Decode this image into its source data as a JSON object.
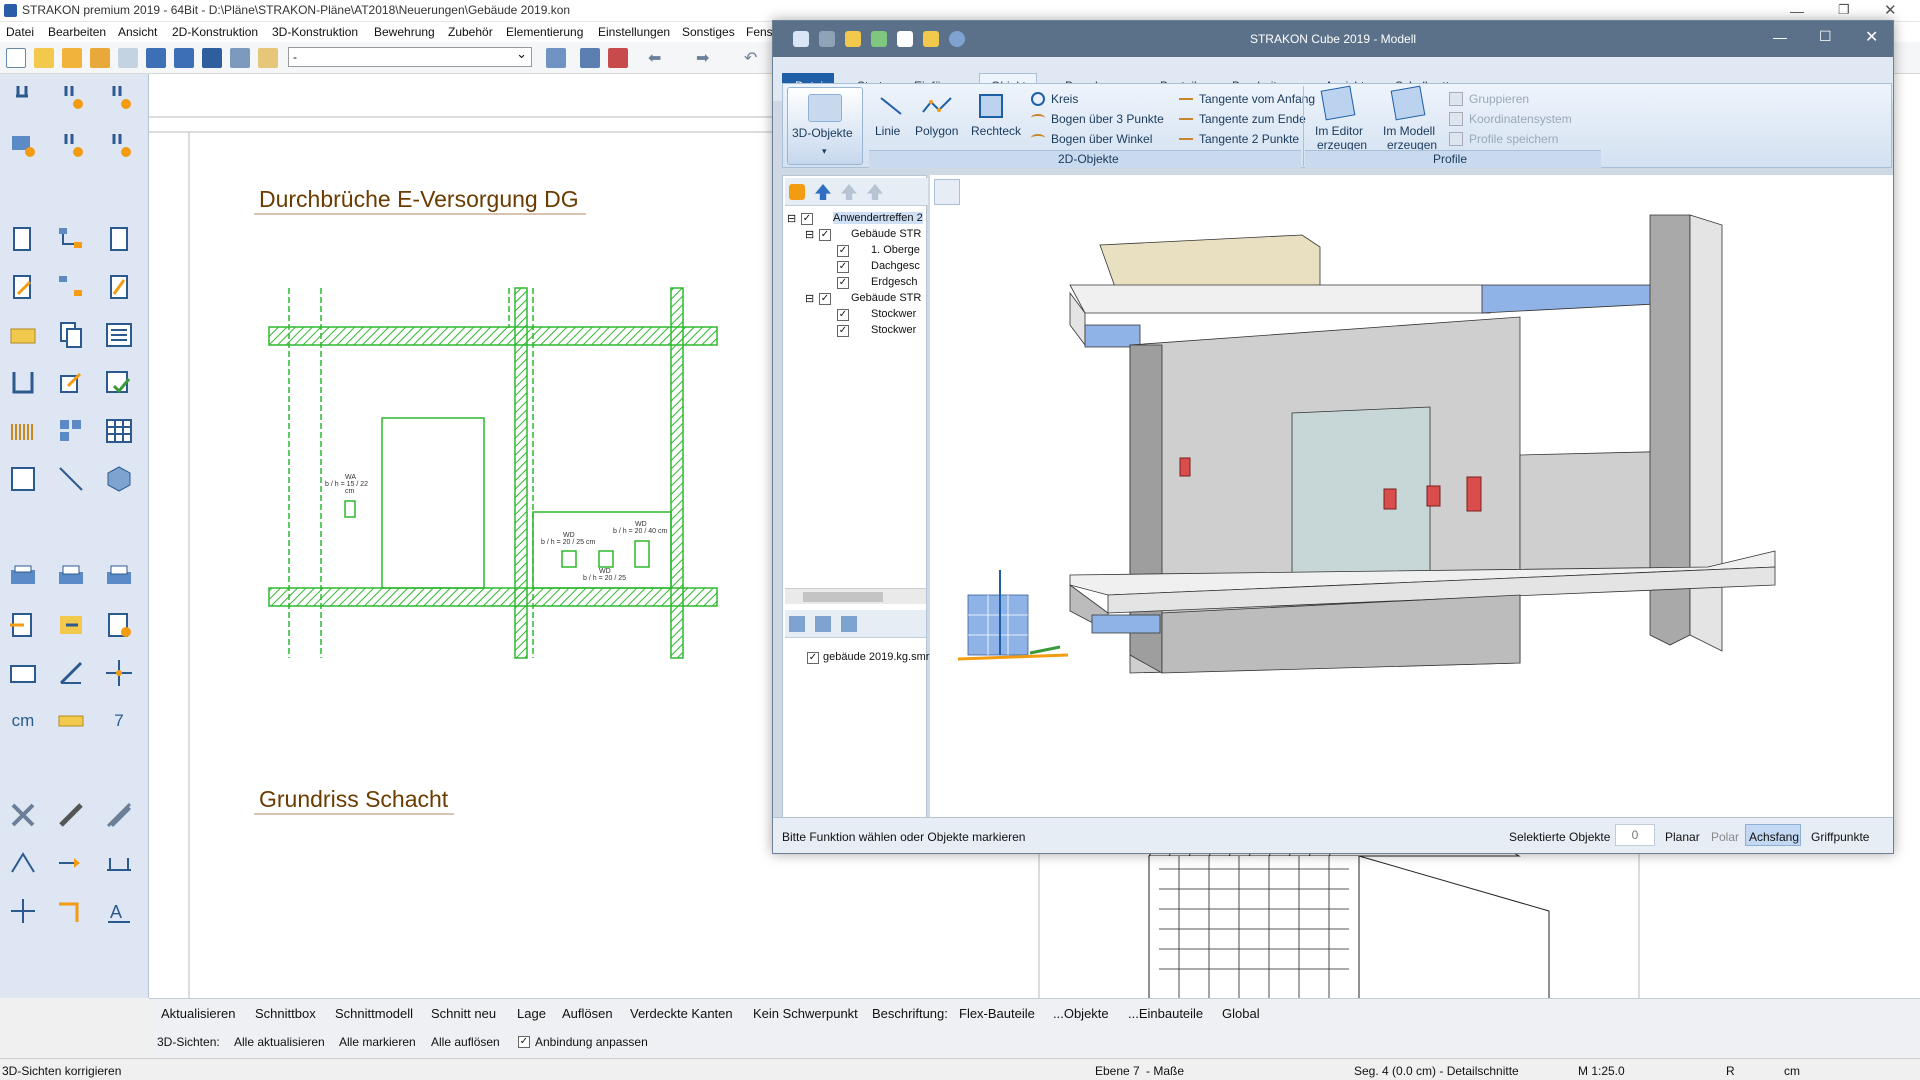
{
  "main_title": "STRAKON premium 2019 - 64Bit  -  D:\\Pläne\\STRAKON-Pläne\\AT2018\\Neuerungen\\Gebäude 2019.kon",
  "menu": [
    "Datei",
    "Bearbeiten",
    "Ansicht",
    "2D-Konstruktion",
    "3D-Konstruktion",
    "Bewehrung",
    "Zubehör",
    "Elementierung",
    "Einstellungen",
    "Sonstiges",
    "Fens"
  ],
  "layer_select": "-",
  "left_tools": {
    "cm": "cm",
    "seven": "7"
  },
  "drawing": {
    "title1": "Durchbrüche E-Versorgung DG",
    "title2": "Grundriss Schacht",
    "label_wa": "WA",
    "label_wa_dim": "b / h = 15 / 22",
    "label_wa_unit": "cm",
    "label_wd1": "WD",
    "label_wd1_dim": "b / h = 20 / 25 cm",
    "label_wd2": "WD",
    "label_wd2_dim": "b / h = 20 / 40 cm",
    "label_wd3": "WD",
    "label_wd3_dim": "b / h = 20 / 25"
  },
  "command_bar": [
    "Aktualisieren",
    "Schnittbox",
    "Schnittmodell",
    "Schnitt neu",
    "Lage",
    "Auflösen",
    "Verdeckte Kanten",
    "Kein Schwerpunkt",
    "Beschriftung:",
    "Flex-Bauteile",
    "...Objekte",
    "...Einbauteile",
    "Global"
  ],
  "view_bar": {
    "label": "3D-Sichten:",
    "items": [
      "Alle aktualisieren",
      "Alle markieren",
      "Alle auflösen"
    ],
    "checkbox": "Anbindung anpassen"
  },
  "statusbar": {
    "left": "3D-Sichten korrigieren",
    "ebene": "Ebene 7",
    "masse": "- Maße",
    "seg": "Seg. 4 (0.0 cm) - Detailschnitte",
    "scale": "M 1:25.0",
    "r": "R",
    "unit": "cm"
  },
  "cube": {
    "title": "STRAKON Cube 2019 - Modell",
    "tabs": [
      "Datei",
      "Start",
      "Einfügen",
      "Objekte",
      "Bewehrung",
      "Bauteile",
      "Bearbeiten",
      "Ansicht",
      "Schalbretter"
    ],
    "active_tab": "Objekte",
    "ribbon": {
      "objects3d": "3D-Objekte",
      "linie": "Linie",
      "polygon": "Polygon",
      "rechteck": "Rechteck",
      "kreis": "Kreis",
      "bogen3": "Bogen über 3 Punkte",
      "bogenw": "Bogen über Winkel",
      "tan_anfang": "Tangente vom Anfang",
      "tan_ende": "Tangente zum Ende",
      "tan_2": "Tangente 2 Punkte",
      "group_2d": "2D-Objekte",
      "im_editor1": "Im Editor",
      "im_editor2": "erzeugen",
      "im_modell1": "Im Modell",
      "im_modell2": "erzeugen",
      "gruppieren": "Gruppieren",
      "koord": "Koordinatensystem",
      "profile_speichern": "Profile speichern",
      "group_profile": "Profile"
    },
    "tree": [
      "Anwendertreffen 2",
      "Gebäude STR",
      "1. Oberge",
      "Dachgesc",
      "Erdgesch",
      "Gebäude STR",
      "Stockwer",
      "Stockwer"
    ],
    "file_item": "gebäude 2019.kg.smr",
    "status_left": "Bitte Funktion wählen oder Objekte markieren",
    "sel_label": "Selektierte Objekte",
    "sel_count": "0",
    "modes": [
      "Planar",
      "Polar",
      "Achsfang",
      "Griffpunkte"
    ],
    "active_mode": "Achsfang"
  },
  "colors": {
    "cad_green": "#2db82d",
    "title_brown": "#6b3c00",
    "ribbon_blue": "#1e5fa8"
  }
}
